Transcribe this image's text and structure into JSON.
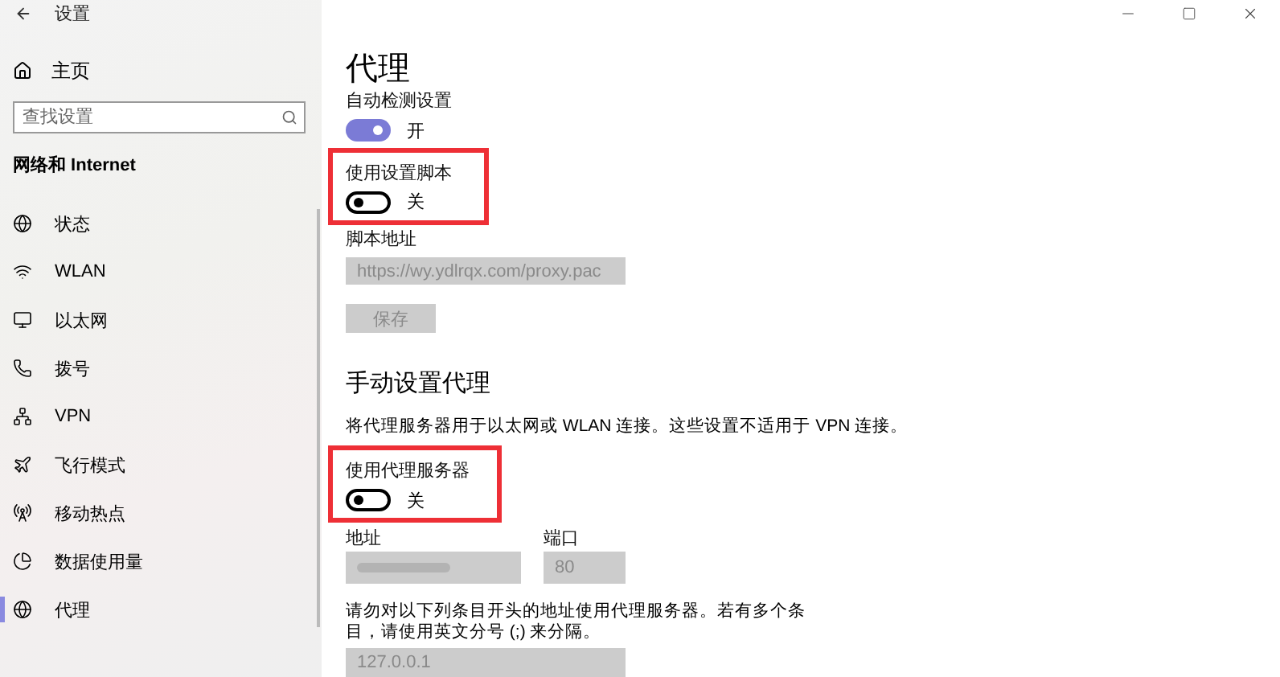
{
  "window": {
    "title": "设置"
  },
  "sidebar": {
    "home": "主页",
    "search": {
      "placeholder": "查找设置"
    },
    "section": "网络和 Internet",
    "items": [
      {
        "kind": "status",
        "label": "状态",
        "selected": false
      },
      {
        "kind": "wlan",
        "label": "WLAN",
        "selected": false
      },
      {
        "kind": "ethernet",
        "label": "以太网",
        "selected": false
      },
      {
        "kind": "dialup",
        "label": "拨号",
        "selected": false
      },
      {
        "kind": "vpn",
        "label": "VPN",
        "selected": false
      },
      {
        "kind": "airplane",
        "label": "飞行模式",
        "selected": false
      },
      {
        "kind": "hotspot",
        "label": "移动热点",
        "selected": false
      },
      {
        "kind": "data",
        "label": "数据使用量",
        "selected": false
      },
      {
        "kind": "proxy",
        "label": "代理",
        "selected": true
      }
    ]
  },
  "page": {
    "title": "代理",
    "auto_detect": {
      "label": "自动检测设置",
      "on": true,
      "state": "开",
      "highlighted": false
    },
    "use_script": {
      "label": "使用设置脚本",
      "on": false,
      "state": "关",
      "highlighted": true
    },
    "script_address": {
      "label": "脚本地址",
      "value": "https://wy.ydlrqx.com/proxy.pac",
      "disabled": true
    },
    "save_button": {
      "label": "保存",
      "disabled": true
    },
    "manual": {
      "heading": "手动设置代理",
      "description": "将代理服务器用于以太网或 WLAN 连接。这些设置不适用于 VPN 连接。",
      "use_proxy": {
        "label": "使用代理服务器",
        "on": false,
        "state": "关",
        "highlighted": true
      },
      "address": {
        "label": "地址",
        "disabled": true
      },
      "port": {
        "label": "端口",
        "value": "80",
        "disabled": true
      },
      "exceptions": {
        "description": "请勿对以下列条目开头的地址使用代理服务器。若有多个条目，请使用英文分号 (;) 来分隔。",
        "value": "127.0.0.1",
        "disabled": true
      }
    }
  }
}
